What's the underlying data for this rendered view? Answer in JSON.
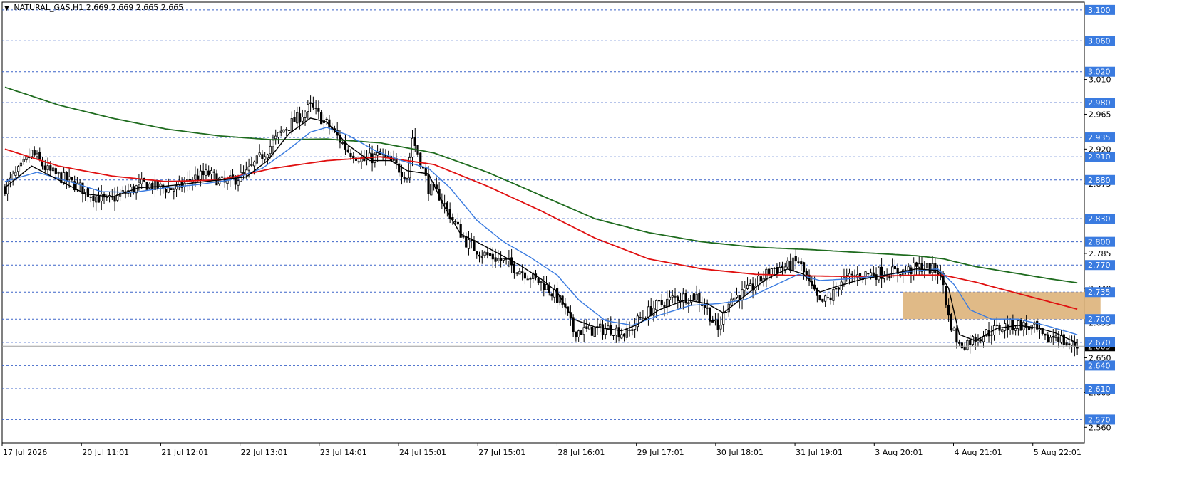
{
  "header": {
    "symbol": "NATURAL_GAS,H1",
    "ohlc": "2.669 2.669 2.665 2.665"
  },
  "colors": {
    "background": "#ffffff",
    "grid": "#3c64c8",
    "candle": "#000000",
    "ma_fast": "#000000",
    "ma_mid": "#3a7be0",
    "ma_slow": "#e01010",
    "ma_long": "#1e6b1e",
    "zone": "#ddb27a",
    "level_badge": "#3a7be0"
  },
  "chart_data": {
    "type": "candlestick",
    "title": "NATURAL_GAS,H1",
    "ylim": [
      2.54,
      3.11
    ],
    "x_ticks": [
      "17 Jul 2026",
      "20 Jul 11:01",
      "21 Jul 12:01",
      "22 Jul 13:01",
      "23 Jul 14:01",
      "24 Jul 15:01",
      "27 Jul 15:01",
      "28 Jul 16:01",
      "29 Jul 17:01",
      "30 Jul 18:01",
      "31 Jul 19:01",
      "3 Aug 20:01",
      "4 Aug 21:01",
      "5 Aug 22:01"
    ],
    "y_ticks": [
      "3.010",
      "2.965",
      "2.920",
      "2.875",
      "2.785",
      "2.740",
      "2.695",
      "2.650",
      "2.605",
      "2.560"
    ],
    "horizontal_levels": [
      "3.100",
      "3.060",
      "3.020",
      "2.980",
      "2.935",
      "2.910",
      "2.880",
      "2.830",
      "2.800",
      "2.770",
      "2.735",
      "2.700",
      "2.670",
      "2.640",
      "2.610",
      "2.570"
    ],
    "current_price": 2.665,
    "current_price_label": "2.665",
    "zone": {
      "from_time": "3 Aug 20:01",
      "to_time": "5 Aug 22:01",
      "price_low": 2.7,
      "price_high": 2.735
    },
    "close_anchors": [
      [
        0,
        2.87
      ],
      [
        6,
        2.895
      ],
      [
        10,
        2.915
      ],
      [
        16,
        2.892
      ],
      [
        24,
        2.878
      ],
      [
        32,
        2.862
      ],
      [
        38,
        2.852
      ],
      [
        44,
        2.862
      ],
      [
        52,
        2.875
      ],
      [
        58,
        2.87
      ],
      [
        64,
        2.868
      ],
      [
        70,
        2.882
      ],
      [
        76,
        2.888
      ],
      [
        82,
        2.875
      ],
      [
        90,
        2.888
      ],
      [
        98,
        2.92
      ],
      [
        104,
        2.945
      ],
      [
        110,
        2.962
      ],
      [
        114,
        2.975
      ],
      [
        118,
        2.96
      ],
      [
        122,
        2.945
      ],
      [
        128,
        2.918
      ],
      [
        134,
        2.905
      ],
      [
        140,
        2.912
      ],
      [
        146,
        2.898
      ],
      [
        150,
        2.885
      ],
      [
        152,
        2.935
      ],
      [
        155,
        2.905
      ],
      [
        158,
        2.87
      ],
      [
        162,
        2.86
      ],
      [
        166,
        2.835
      ],
      [
        172,
        2.8
      ],
      [
        178,
        2.785
      ],
      [
        186,
        2.775
      ],
      [
        194,
        2.76
      ],
      [
        202,
        2.742
      ],
      [
        208,
        2.72
      ],
      [
        212,
        2.685
      ],
      [
        218,
        2.685
      ],
      [
        226,
        2.688
      ],
      [
        232,
        2.68
      ],
      [
        236,
        2.698
      ],
      [
        242,
        2.715
      ],
      [
        250,
        2.728
      ],
      [
        258,
        2.73
      ],
      [
        262,
        2.712
      ],
      [
        266,
        2.685
      ],
      [
        270,
        2.725
      ],
      [
        278,
        2.738
      ],
      [
        286,
        2.765
      ],
      [
        292,
        2.768
      ],
      [
        296,
        2.775
      ],
      [
        300,
        2.745
      ],
      [
        304,
        2.72
      ],
      [
        308,
        2.728
      ],
      [
        312,
        2.75
      ],
      [
        320,
        2.758
      ],
      [
        328,
        2.76
      ],
      [
        336,
        2.762
      ],
      [
        342,
        2.768
      ],
      [
        348,
        2.762
      ],
      [
        350,
        2.745
      ],
      [
        352,
        2.702
      ],
      [
        356,
        2.665
      ],
      [
        360,
        2.672
      ],
      [
        366,
        2.682
      ],
      [
        372,
        2.69
      ],
      [
        378,
        2.693
      ],
      [
        384,
        2.688
      ],
      [
        388,
        2.672
      ],
      [
        392,
        2.68
      ],
      [
        396,
        2.668
      ],
      [
        400,
        2.665
      ]
    ],
    "ma_fast_anchors": [
      [
        0,
        2.87
      ],
      [
        10,
        2.898
      ],
      [
        20,
        2.88
      ],
      [
        30,
        2.862
      ],
      [
        40,
        2.858
      ],
      [
        50,
        2.87
      ],
      [
        60,
        2.872
      ],
      [
        70,
        2.876
      ],
      [
        80,
        2.88
      ],
      [
        90,
        2.884
      ],
      [
        98,
        2.905
      ],
      [
        106,
        2.94
      ],
      [
        114,
        2.96
      ],
      [
        120,
        2.955
      ],
      [
        128,
        2.925
      ],
      [
        136,
        2.905
      ],
      [
        144,
        2.905
      ],
      [
        150,
        2.892
      ],
      [
        158,
        2.888
      ],
      [
        164,
        2.845
      ],
      [
        170,
        2.81
      ],
      [
        176,
        2.8
      ],
      [
        184,
        2.785
      ],
      [
        192,
        2.77
      ],
      [
        200,
        2.752
      ],
      [
        206,
        2.735
      ],
      [
        212,
        2.7
      ],
      [
        220,
        2.69
      ],
      [
        230,
        2.685
      ],
      [
        236,
        2.693
      ],
      [
        244,
        2.712
      ],
      [
        254,
        2.725
      ],
      [
        262,
        2.72
      ],
      [
        268,
        2.708
      ],
      [
        276,
        2.73
      ],
      [
        284,
        2.752
      ],
      [
        292,
        2.765
      ],
      [
        298,
        2.758
      ],
      [
        304,
        2.735
      ],
      [
        310,
        2.742
      ],
      [
        320,
        2.752
      ],
      [
        330,
        2.758
      ],
      [
        340,
        2.765
      ],
      [
        348,
        2.763
      ],
      [
        352,
        2.74
      ],
      [
        356,
        2.68
      ],
      [
        362,
        2.672
      ],
      [
        370,
        2.688
      ],
      [
        378,
        2.692
      ],
      [
        386,
        2.688
      ],
      [
        392,
        2.682
      ],
      [
        400,
        2.669
      ]
    ],
    "ma_mid_anchors": [
      [
        0,
        2.878
      ],
      [
        12,
        2.89
      ],
      [
        24,
        2.878
      ],
      [
        36,
        2.865
      ],
      [
        48,
        2.864
      ],
      [
        60,
        2.87
      ],
      [
        72,
        2.874
      ],
      [
        84,
        2.88
      ],
      [
        96,
        2.895
      ],
      [
        106,
        2.92
      ],
      [
        114,
        2.942
      ],
      [
        120,
        2.948
      ],
      [
        128,
        2.938
      ],
      [
        138,
        2.918
      ],
      [
        148,
        2.905
      ],
      [
        158,
        2.895
      ],
      [
        166,
        2.87
      ],
      [
        176,
        2.828
      ],
      [
        186,
        2.8
      ],
      [
        196,
        2.78
      ],
      [
        206,
        2.757
      ],
      [
        214,
        2.725
      ],
      [
        224,
        2.698
      ],
      [
        234,
        2.692
      ],
      [
        244,
        2.705
      ],
      [
        256,
        2.718
      ],
      [
        266,
        2.72
      ],
      [
        276,
        2.725
      ],
      [
        286,
        2.742
      ],
      [
        296,
        2.758
      ],
      [
        304,
        2.75
      ],
      [
        314,
        2.752
      ],
      [
        326,
        2.756
      ],
      [
        338,
        2.762
      ],
      [
        348,
        2.765
      ],
      [
        354,
        2.745
      ],
      [
        360,
        2.712
      ],
      [
        368,
        2.7
      ],
      [
        378,
        2.7
      ],
      [
        388,
        2.692
      ],
      [
        400,
        2.68
      ]
    ],
    "ma_slow_anchors": [
      [
        0,
        2.92
      ],
      [
        20,
        2.898
      ],
      [
        40,
        2.885
      ],
      [
        60,
        2.878
      ],
      [
        80,
        2.88
      ],
      [
        100,
        2.895
      ],
      [
        120,
        2.905
      ],
      [
        140,
        2.91
      ],
      [
        160,
        2.9
      ],
      [
        180,
        2.872
      ],
      [
        200,
        2.84
      ],
      [
        220,
        2.805
      ],
      [
        240,
        2.778
      ],
      [
        260,
        2.765
      ],
      [
        280,
        2.758
      ],
      [
        300,
        2.756
      ],
      [
        320,
        2.755
      ],
      [
        340,
        2.757
      ],
      [
        350,
        2.757
      ],
      [
        362,
        2.748
      ],
      [
        376,
        2.735
      ],
      [
        390,
        2.722
      ],
      [
        400,
        2.713
      ]
    ],
    "ma_long_anchors": [
      [
        0,
        3.0
      ],
      [
        20,
        2.977
      ],
      [
        40,
        2.96
      ],
      [
        60,
        2.946
      ],
      [
        80,
        2.937
      ],
      [
        100,
        2.932
      ],
      [
        120,
        2.933
      ],
      [
        140,
        2.928
      ],
      [
        160,
        2.915
      ],
      [
        180,
        2.89
      ],
      [
        200,
        2.86
      ],
      [
        220,
        2.83
      ],
      [
        240,
        2.812
      ],
      [
        260,
        2.8
      ],
      [
        280,
        2.793
      ],
      [
        300,
        2.79
      ],
      [
        320,
        2.786
      ],
      [
        340,
        2.782
      ],
      [
        350,
        2.778
      ],
      [
        362,
        2.768
      ],
      [
        376,
        2.76
      ],
      [
        390,
        2.752
      ],
      [
        400,
        2.747
      ]
    ]
  }
}
